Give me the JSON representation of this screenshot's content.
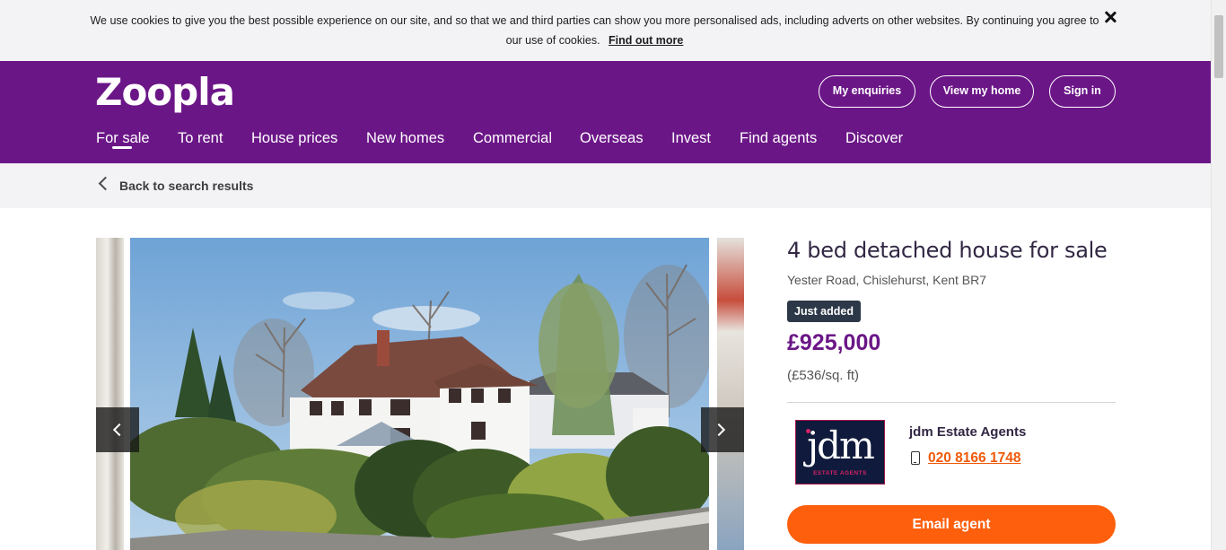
{
  "cookie_banner": {
    "text": "We use cookies to give you the best possible experience on our site, and so that we and third parties can show you more personalised ads, including adverts on other websites. By continuing you agree to our use of cookies.",
    "link_label": "Find out more"
  },
  "header": {
    "logo_text": "Zoopla",
    "buttons": {
      "enquiries": "My enquiries",
      "view_home": "View my home",
      "sign_in": "Sign in"
    },
    "nav": [
      "For sale",
      "To rent",
      "House prices",
      "New homes",
      "Commercial",
      "Overseas",
      "Invest",
      "Find agents",
      "Discover"
    ],
    "active_nav": "For sale",
    "brand_color": "#6b1687"
  },
  "back_link": "Back to search results",
  "listing": {
    "title": "4 bed detached house for sale",
    "address": "Yester Road, Chislehurst, Kent BR7",
    "badge": "Just added",
    "price": "£925,000",
    "price_per_sqft": "(£536/sq. ft)"
  },
  "agent": {
    "logo_text": "jdm",
    "logo_subtext": "ESTATE AGENTS",
    "name": "jdm Estate Agents",
    "phone": "020 8166 1748",
    "phone_icon": "phone-icon",
    "email_button": "Email agent",
    "accent_color": "#fe5f0d"
  },
  "gallery": {
    "prev_icon": "chevron-left-icon",
    "next_icon": "chevron-right-icon"
  }
}
